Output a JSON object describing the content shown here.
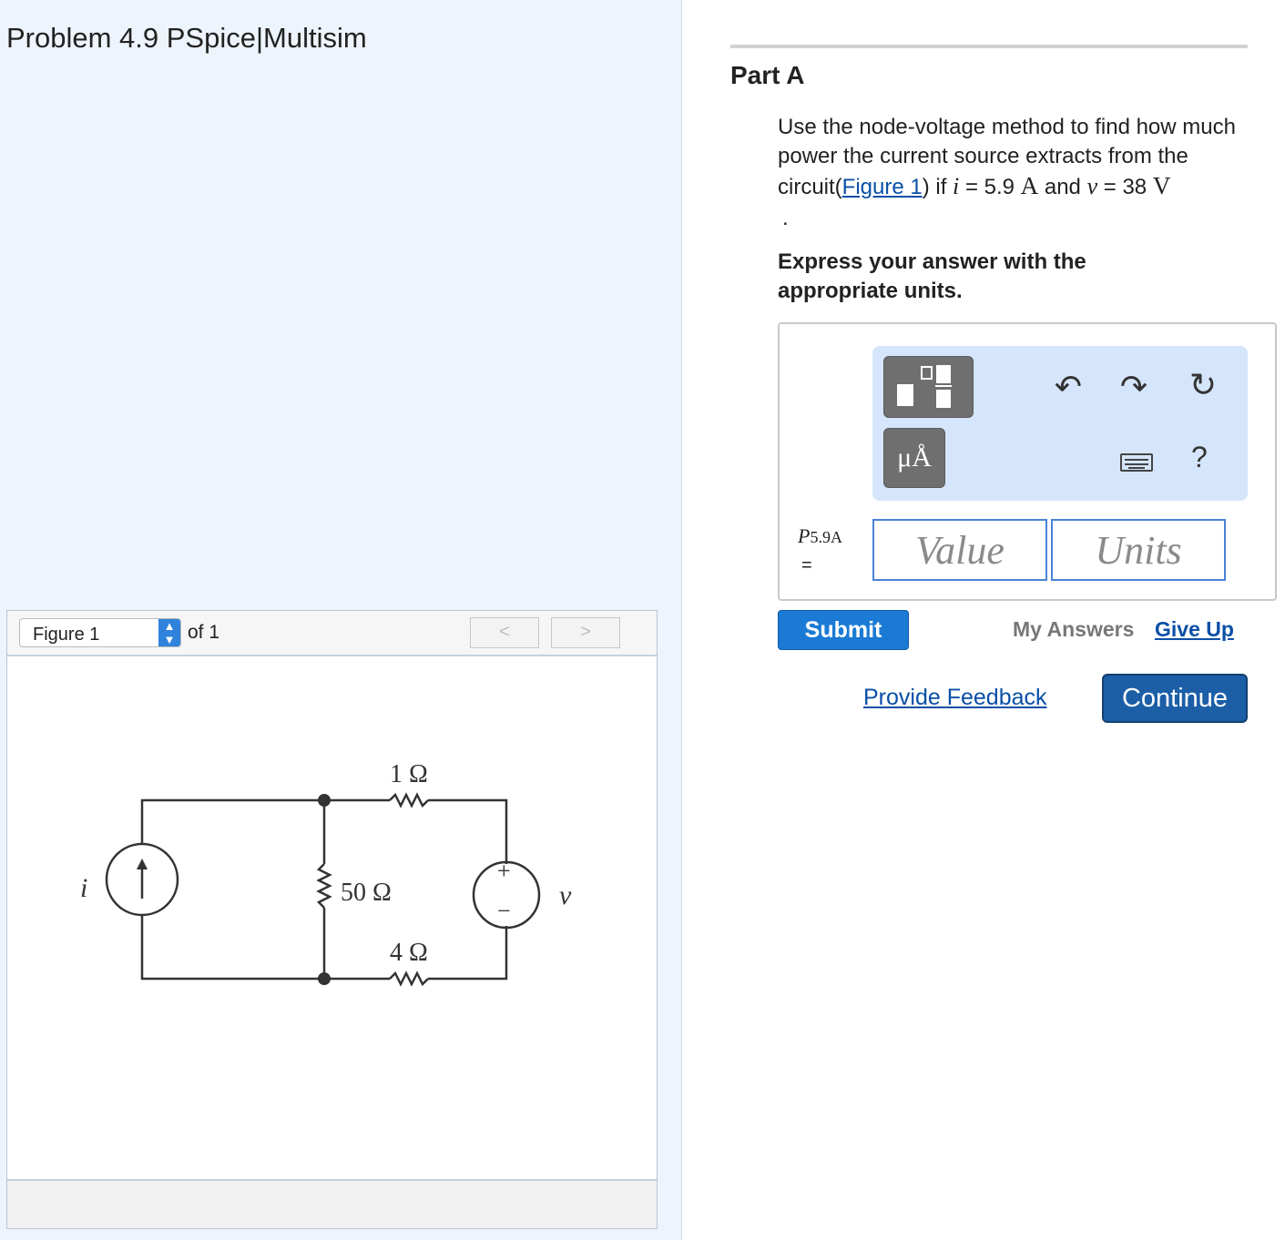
{
  "problem": {
    "title": "Problem 4.9 PSpice|Multisim"
  },
  "figure_panel": {
    "selected": "Figure 1",
    "of_label": "of 1",
    "prev_label": "<",
    "next_label": ">",
    "circuit": {
      "r_top": "1 Ω",
      "r_mid": "50 Ω",
      "r_bottom": "4 Ω",
      "current_label": "i",
      "voltage_label": "v",
      "plus": "+",
      "minus": "−"
    }
  },
  "part": {
    "title": "Part A",
    "question": {
      "text1": "Use the node-voltage method to find how much power the current source extracts from the circuit(",
      "link": "Figure 1",
      "text2": ") if ",
      "var_i": "i",
      "text3": " = 5.9 ",
      "unit_i": "A",
      "text4": " and ",
      "var_v": "v",
      "text5": " = 38 ",
      "unit_v": "V",
      "trailing": "."
    },
    "instruction": "Express your answer with the appropriate units."
  },
  "answer": {
    "units_button": "μÅ",
    "help": "?",
    "var_name": "P",
    "var_sub": "5.9A",
    "equals": "=",
    "value_placeholder": "Value",
    "units_placeholder": "Units"
  },
  "actions": {
    "submit": "Submit",
    "my_answers": "My Answers",
    "give_up": "Give Up",
    "feedback": "Provide Feedback",
    "continue": "Continue"
  },
  "colors": {
    "left_pane_bg": "#eef4fc",
    "toolbar_bg": "#d5e5fb",
    "submit_bg": "#1a7ad4",
    "continue_bg": "#1c5fa7",
    "link": "#0a4fa6",
    "input_border": "#4a82d6"
  },
  "icons": [
    "chevron-updown-icon",
    "template-icon",
    "undo-icon",
    "redo-icon",
    "reset-icon",
    "keyboard-icon",
    "help-icon"
  ]
}
